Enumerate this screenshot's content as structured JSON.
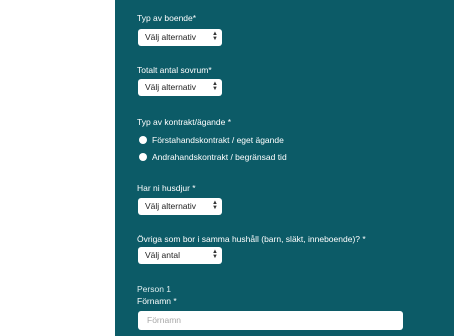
{
  "form": {
    "housing_type": {
      "label": "Typ av boende*",
      "value": "Välj alternativ"
    },
    "bedrooms": {
      "label": "Totalt antal sovrum*",
      "value": "Välj alternativ"
    },
    "contract": {
      "label": "Typ av kontrakt/ägande *",
      "options": [
        "Förstahandskontrakt / eget ägande",
        "Andrahandskontrakt / begränsad tid"
      ]
    },
    "pets": {
      "label": "Har ni husdjur *",
      "value": "Välj alternativ"
    },
    "others": {
      "label": "Övriga som bor i samma hushåll (barn, släkt, inneboende)? *",
      "value": "Välj antal"
    },
    "person": {
      "heading": "Person 1",
      "first_name_label": "Förnamn *",
      "first_name_placeholder": "Förnamn"
    }
  },
  "icons": {
    "select_arrows": "up-down-chevron-icon"
  }
}
